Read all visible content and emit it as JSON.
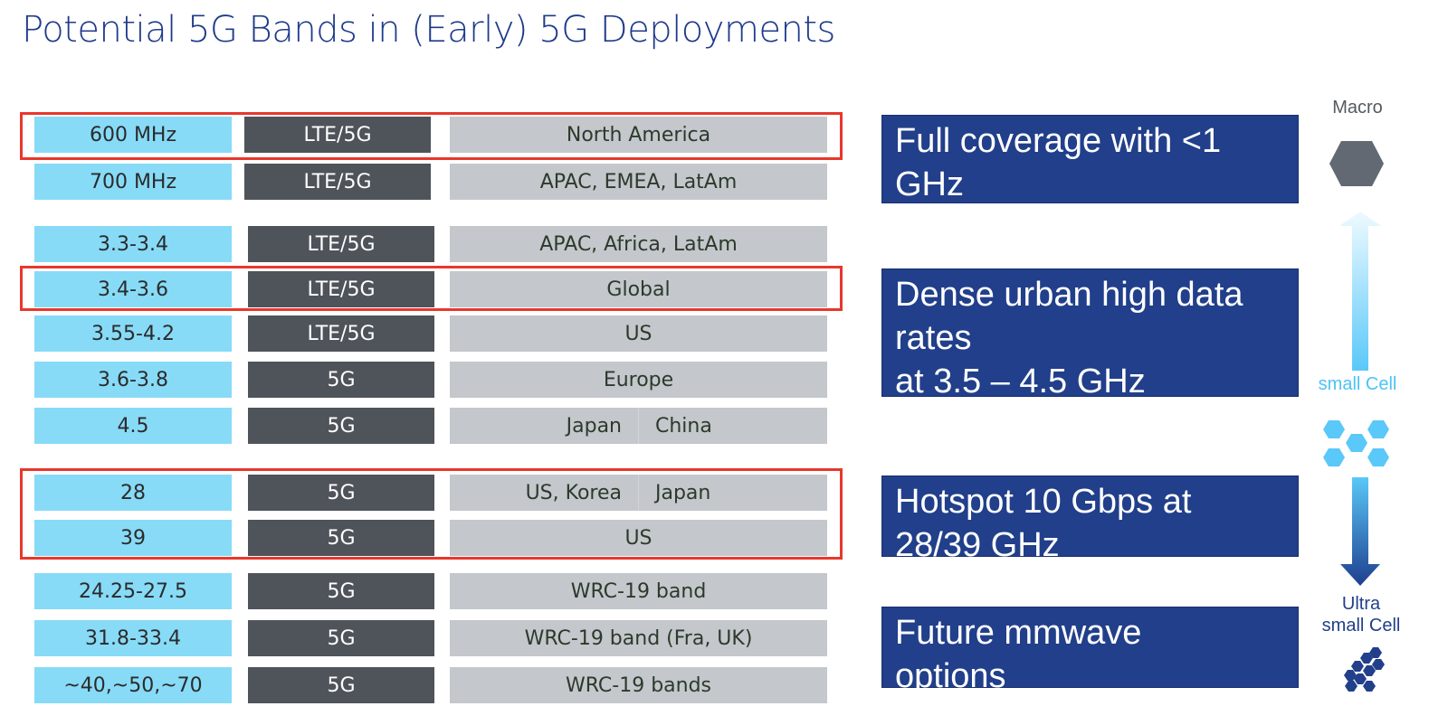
{
  "title": "Potential 5G Bands in (Early) 5G Deployments",
  "bands": [
    {
      "freq": "600 MHz",
      "tech": "LTE/5G",
      "region": "North America"
    },
    {
      "freq": "700 MHz",
      "tech": "LTE/5G",
      "region": "APAC, EMEA, LatAm"
    },
    {
      "freq": "3.3-3.4",
      "tech": "LTE/5G",
      "region": "APAC, Africa, LatAm"
    },
    {
      "freq": "3.4-3.6",
      "tech": "LTE/5G",
      "region": "Global"
    },
    {
      "freq": "3.55-4.2",
      "tech": "LTE/5G",
      "region": "US"
    },
    {
      "freq": "3.6-3.8",
      "tech": "5G",
      "region": "Europe"
    },
    {
      "freq": "4.5",
      "tech": "5G",
      "region_left": "Japan",
      "region_right": "China"
    },
    {
      "freq": "28",
      "tech": "5G",
      "region_left": "US, Korea",
      "region_right": "Japan"
    },
    {
      "freq": "39",
      "tech": "5G",
      "region": "US"
    },
    {
      "freq": "24.25-27.5",
      "tech": "5G",
      "region": "WRC-19 band"
    },
    {
      "freq": "31.8-33.4",
      "tech": "5G",
      "region": "WRC-19 band (Fra, UK)"
    },
    {
      "freq": "~40,~50,~70",
      "tech": "5G",
      "region": "WRC-19 bands"
    }
  ],
  "use_cases": [
    {
      "lines": [
        "Full coverage with <1",
        "GHz"
      ]
    },
    {
      "lines": [
        "Dense urban high data",
        "rates",
        "at 3.5 – 4.5 GHz"
      ]
    },
    {
      "lines": [
        "Hotspot 10 Gbps at",
        "28/39 GHz"
      ]
    },
    {
      "lines": [
        "Future mmwave",
        "options"
      ]
    }
  ],
  "cell_scale": {
    "macro_label": "Macro",
    "small_cell_label": "small Cell",
    "ultra_small_label_1": "Ultra",
    "ultra_small_label_2": "small Cell"
  },
  "colors": {
    "frequency_cell": "#87dbf7",
    "tech_cell": "#4f535a",
    "region_cell": "#c4c7cb",
    "highlight_border": "#e8372c",
    "use_case_box": "#213f8a",
    "title": "#1e3a8a"
  }
}
